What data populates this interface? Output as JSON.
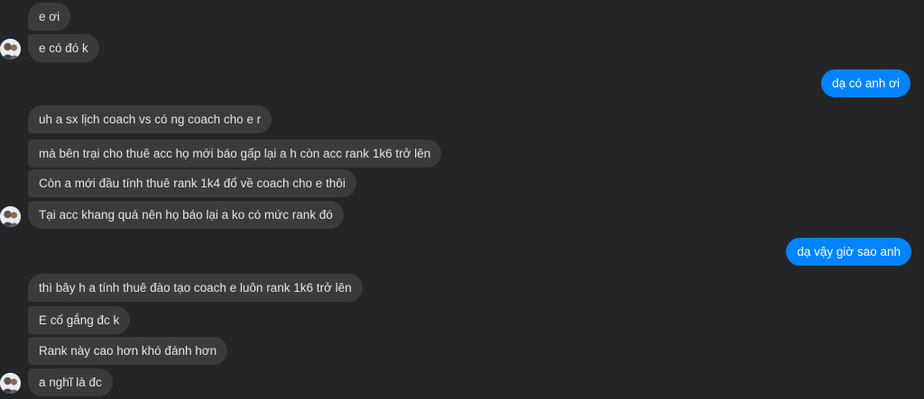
{
  "colors": {
    "background": "#242526",
    "incoming_bubble": "#3a3b3c",
    "outgoing_bubble": "#0084ff",
    "text": "#e4e6eb"
  },
  "messages": [
    {
      "side": "in",
      "text": "e ơi"
    },
    {
      "side": "in",
      "text": "e có đó k"
    },
    {
      "side": "out",
      "text": "dạ có anh ơi"
    },
    {
      "side": "in",
      "text": "uh a sx lịch coach vs có ng coach cho e r"
    },
    {
      "side": "in",
      "text": "mà bên trại cho thuê acc họ mới báo gấp lại a h còn acc rank 1k6 trở lên"
    },
    {
      "side": "in",
      "text": "Còn a mới đầu tính thuê rank 1k4 đổ về coach cho e thôi"
    },
    {
      "side": "in",
      "text": "Tại acc khang quá nên họ báo lại a ko có mức rank đó"
    },
    {
      "side": "out",
      "text": "dạ vậy giờ sao anh"
    },
    {
      "side": "in",
      "text": "thì bây h a tính thuê đào tạo coach e luôn rank 1k6 trở lên"
    },
    {
      "side": "in",
      "text": "E cố gắng đc k"
    },
    {
      "side": "in",
      "text": "Rank này cao hơn khó đánh hơn"
    },
    {
      "side": "in",
      "text": "a nghĩ là đc"
    }
  ],
  "avatar": {
    "icon": "user-avatar-photo"
  }
}
